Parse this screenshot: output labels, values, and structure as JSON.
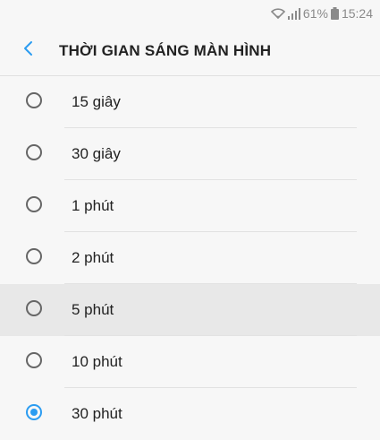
{
  "status_bar": {
    "battery_percent": "61%",
    "time": "15:24",
    "icons": [
      "wifi-icon",
      "signal-icon",
      "battery-icon"
    ]
  },
  "header": {
    "back_icon": "chevron-left-icon",
    "title": "THỜI GIAN SÁNG MÀN HÌNH"
  },
  "colors": {
    "accent": "#2b9cf1",
    "highlight_row": "#e8e8e8",
    "background": "#f7f7f7"
  },
  "options": [
    {
      "label": "15 giây",
      "selected": false,
      "highlighted": false
    },
    {
      "label": "30 giây",
      "selected": false,
      "highlighted": false
    },
    {
      "label": "1 phút",
      "selected": false,
      "highlighted": false
    },
    {
      "label": "2 phút",
      "selected": false,
      "highlighted": false
    },
    {
      "label": "5 phút",
      "selected": false,
      "highlighted": true
    },
    {
      "label": "10 phút",
      "selected": false,
      "highlighted": false
    },
    {
      "label": "30 phút",
      "selected": true,
      "highlighted": false
    }
  ]
}
